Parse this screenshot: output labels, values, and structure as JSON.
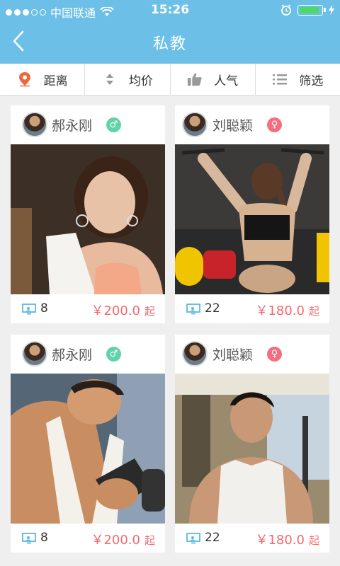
{
  "status_bar": {
    "carrier": "中国联通",
    "time": "15:26",
    "battery_level": 0.9
  },
  "header": {
    "title": "私教"
  },
  "filters": [
    {
      "label": "距离",
      "icon": "location-pin-icon"
    },
    {
      "label": "均价",
      "icon": "sort-arrows-icon"
    },
    {
      "label": "人气",
      "icon": "thumbs-up-icon"
    },
    {
      "label": "筛选",
      "icon": "list-filter-icon"
    }
  ],
  "trainers": [
    {
      "name": "郝永刚",
      "gender": "♂",
      "gender_type": "male",
      "count": "8",
      "price": "￥200.0",
      "price_suffix": "起"
    },
    {
      "name": "刘聪颖",
      "gender": "♀",
      "gender_type": "female",
      "count": "22",
      "price": "￥180.0",
      "price_suffix": "起"
    },
    {
      "name": "郝永刚",
      "gender": "♂",
      "gender_type": "male",
      "count": "8",
      "price": "￥200.0",
      "price_suffix": "起"
    },
    {
      "name": "刘聪颖",
      "gender": "♀",
      "gender_type": "female",
      "count": "22",
      "price": "￥180.0",
      "price_suffix": "起"
    }
  ],
  "colors": {
    "nav_bg": "#6cc0e8",
    "price": "#f26a6f",
    "male_badge": "#62d3a8",
    "female_badge": "#f56d7f",
    "pin": "#f0663a"
  }
}
